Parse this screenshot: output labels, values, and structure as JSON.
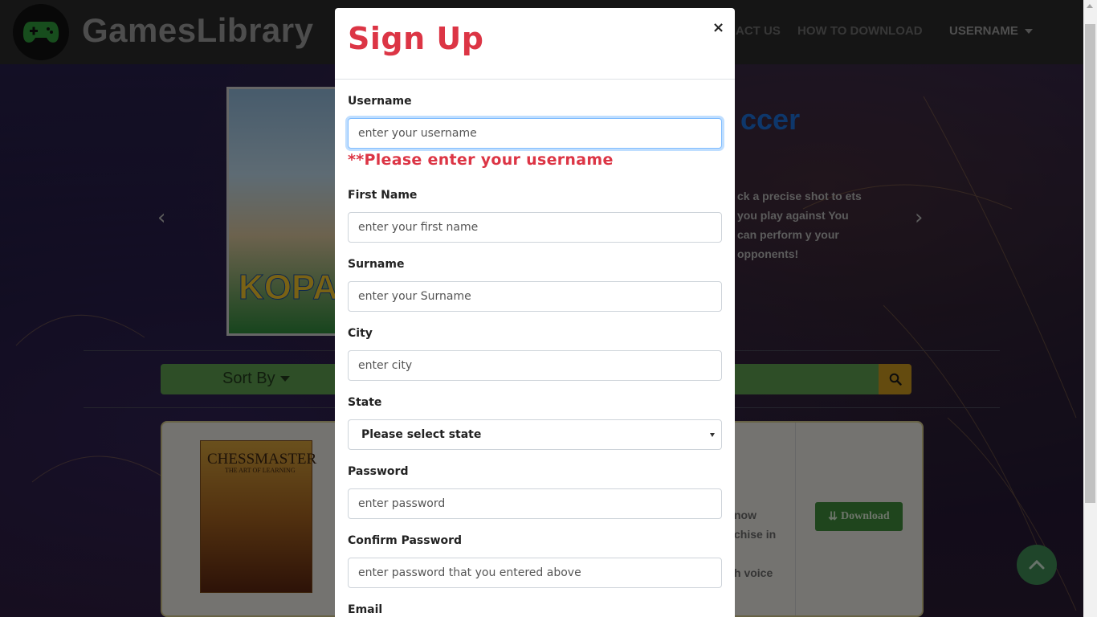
{
  "navbar": {
    "brand": "GamesLibrary",
    "links": {
      "contact": "ACT US",
      "how_to_download": "HOW TO DOWNLOAD",
      "username": "USERNAME"
    }
  },
  "carousel": {
    "title": "ccer",
    "description": "ck a precise shot to ets you play against You can perform y your opponents!",
    "cover_text": "KOPA"
  },
  "filters": {
    "sort_label": "Sort By"
  },
  "game_card": {
    "cover_title": "CHESSMASTER",
    "cover_subtitle": "THE ART OF LEARNING",
    "text_line_1": "now",
    "text_line_2": "chise in",
    "text_line_3": "h voice",
    "download_label": "Download"
  },
  "modal": {
    "title": "Sign Up",
    "close": "×",
    "fields": {
      "username": {
        "label": "Username",
        "placeholder": "enter your username",
        "error": "**Please enter your username"
      },
      "first_name": {
        "label": "First Name",
        "placeholder": "enter your first name"
      },
      "surname": {
        "label": "Surname",
        "placeholder": "enter your Surname"
      },
      "city": {
        "label": "City",
        "placeholder": "enter city"
      },
      "state": {
        "label": "State",
        "selected": "Please select state"
      },
      "password": {
        "label": "Password",
        "placeholder": "enter password"
      },
      "confirm_password": {
        "label": "Confirm Password",
        "placeholder": "enter password that you entered above"
      },
      "email": {
        "label": "Email"
      }
    }
  },
  "colors": {
    "accent_red": "#dc3545",
    "focus_blue": "#80bdff",
    "nav_bg": "#2b2b2b",
    "download_green": "#3f8a3a"
  }
}
